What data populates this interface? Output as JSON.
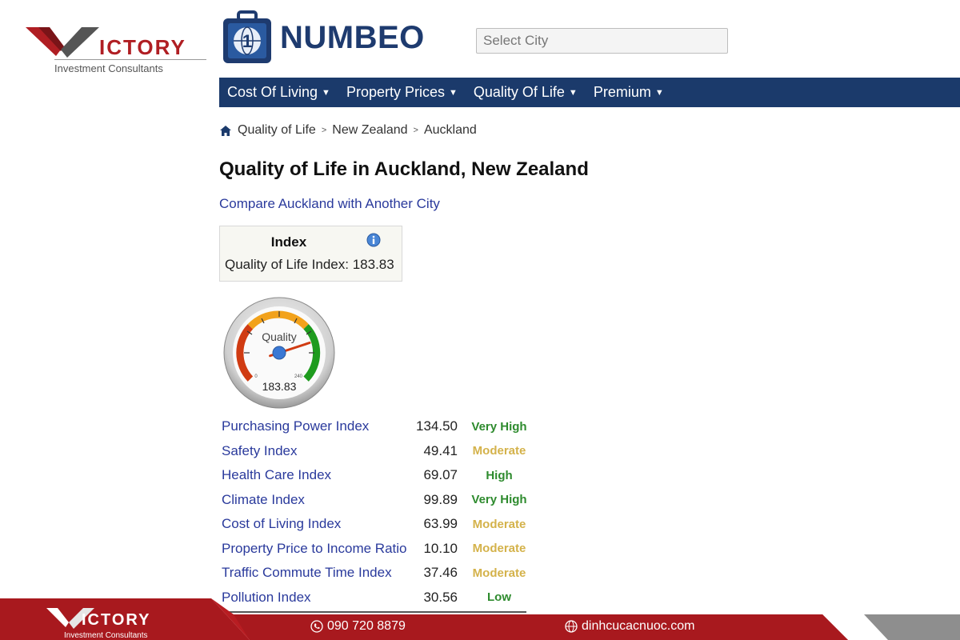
{
  "victory": {
    "brand": "ICTORY",
    "tagline": "Investment Consultants"
  },
  "numbeo": {
    "logo_text": "NUMBEO"
  },
  "search": {
    "placeholder": "Select City"
  },
  "nav": {
    "items": [
      {
        "label": "Cost Of Living"
      },
      {
        "label": "Property Prices"
      },
      {
        "label": "Quality Of Life"
      },
      {
        "label": "Premium"
      }
    ]
  },
  "breadcrumb": {
    "items": [
      "Quality of Life",
      "New Zealand",
      "Auckland"
    ]
  },
  "page": {
    "title": "Quality of Life in Auckland, New Zealand",
    "compare_link": "Compare Auckland with Another City"
  },
  "index_box": {
    "header": "Index",
    "label": "Quality of Life Index:",
    "value": "183.83"
  },
  "gauge": {
    "label": "Quality",
    "value_text": "183.83",
    "value": 183.83,
    "min_label": "0",
    "max_label": "240",
    "min": 0,
    "max": 240
  },
  "indices": [
    {
      "name": "Purchasing Power Index",
      "value": "134.50",
      "rating": "Very High",
      "color": "#2e8b2e"
    },
    {
      "name": "Safety Index",
      "value": "49.41",
      "rating": "Moderate",
      "color": "#d4b24a"
    },
    {
      "name": "Health Care Index",
      "value": "69.07",
      "rating": "High",
      "color": "#2e8b2e"
    },
    {
      "name": "Climate Index",
      "value": "99.89",
      "rating": "Very High",
      "color": "#2e8b2e"
    },
    {
      "name": "Cost of Living Index",
      "value": "63.99",
      "rating": "Moderate",
      "color": "#d4b24a"
    },
    {
      "name": "Property Price to Income Ratio",
      "value": "10.10",
      "rating": "Moderate",
      "color": "#d4b24a"
    },
    {
      "name": "Traffic Commute Time Index",
      "value": "37.46",
      "rating": "Moderate",
      "color": "#d4b24a"
    },
    {
      "name": "Pollution Index",
      "value": "30.56",
      "rating": "Low",
      "color": "#2e8b2e"
    }
  ],
  "footer": {
    "brand": "ICTORY",
    "tagline": "Investment Consultants",
    "phone": "090 720 8879",
    "website": "dinhcucacnuoc.com",
    "phone_icon": "phone-icon",
    "web_icon": "globe-icon"
  },
  "colors": {
    "nav_bg": "#1b3a6b",
    "brand_red": "#b01e23",
    "link_blue": "#2a3a9c",
    "footer_red": "#a8191e"
  }
}
